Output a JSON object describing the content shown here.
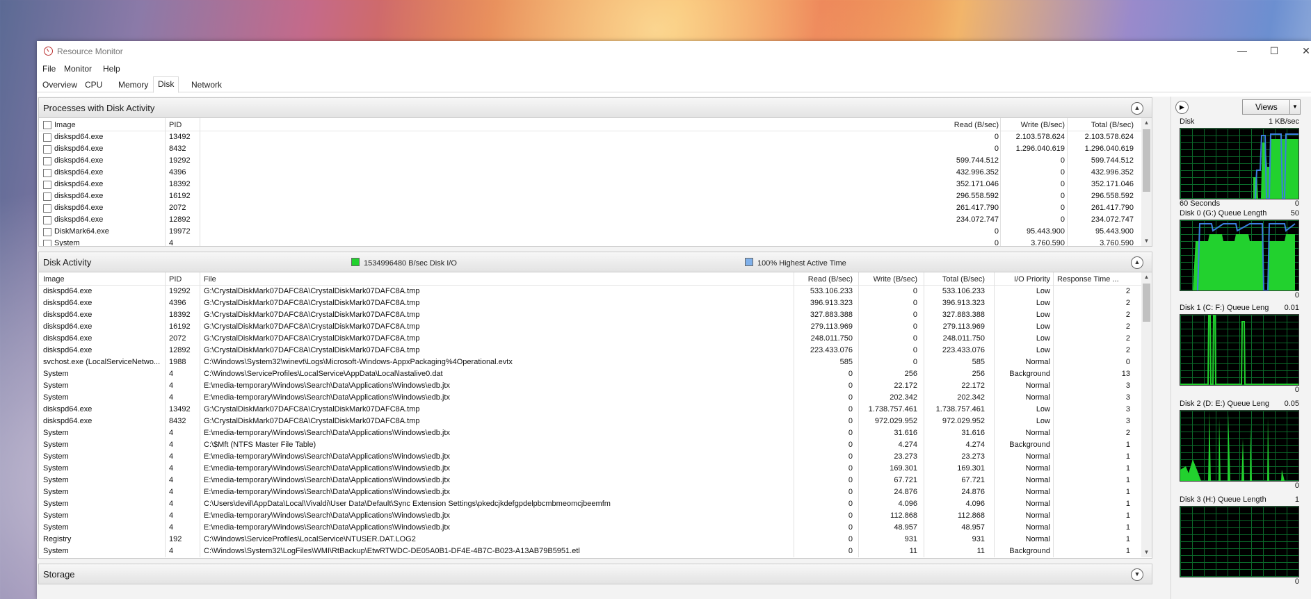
{
  "window": {
    "title": "Resource Monitor",
    "controls": {
      "minimize": "—",
      "maximize": "☐",
      "close": "✕"
    }
  },
  "menu": [
    "File",
    "Monitor",
    "Help"
  ],
  "tabs": [
    "Overview",
    "CPU",
    "Memory",
    "Disk",
    "Network"
  ],
  "active_tab": "Disk",
  "processes": {
    "title": "Processes with Disk Activity",
    "headers": {
      "image": "Image",
      "pid": "PID",
      "read": "Read (B/sec)",
      "write": "Write (B/sec)",
      "total": "Total (B/sec)"
    },
    "rows": [
      {
        "image": "diskspd64.exe",
        "pid": "13492",
        "read": "0",
        "write": "2.103.578.624",
        "total": "2.103.578.624"
      },
      {
        "image": "diskspd64.exe",
        "pid": "8432",
        "read": "0",
        "write": "1.296.040.619",
        "total": "1.296.040.619"
      },
      {
        "image": "diskspd64.exe",
        "pid": "19292",
        "read": "599.744.512",
        "write": "0",
        "total": "599.744.512"
      },
      {
        "image": "diskspd64.exe",
        "pid": "4396",
        "read": "432.996.352",
        "write": "0",
        "total": "432.996.352"
      },
      {
        "image": "diskspd64.exe",
        "pid": "18392",
        "read": "352.171.046",
        "write": "0",
        "total": "352.171.046"
      },
      {
        "image": "diskspd64.exe",
        "pid": "16192",
        "read": "296.558.592",
        "write": "0",
        "total": "296.558.592"
      },
      {
        "image": "diskspd64.exe",
        "pid": "2072",
        "read": "261.417.790",
        "write": "0",
        "total": "261.417.790"
      },
      {
        "image": "diskspd64.exe",
        "pid": "12892",
        "read": "234.072.747",
        "write": "0",
        "total": "234.072.747"
      },
      {
        "image": "DiskMark64.exe",
        "pid": "19972",
        "read": "0",
        "write": "95.443.900",
        "total": "95.443.900"
      },
      {
        "image": "System",
        "pid": "4",
        "read": "0",
        "write": "3.760.590",
        "total": "3.760.590"
      }
    ]
  },
  "disk_activity": {
    "title": "Disk Activity",
    "legend_io": "1534996480 B/sec Disk I/O",
    "legend_active": "100% Highest Active Time",
    "colors": {
      "io": "#22d12e",
      "active": "#7fb0ea"
    },
    "headers": {
      "image": "Image",
      "pid": "PID",
      "file": "File",
      "read": "Read (B/sec)",
      "write": "Write (B/sec)",
      "total": "Total (B/sec)",
      "priority": "I/O Priority",
      "response": "Response Time ..."
    },
    "rows": [
      {
        "image": "diskspd64.exe",
        "pid": "19292",
        "file": "G:\\CrystalDiskMark07DAFC8A\\CrystalDiskMark07DAFC8A.tmp",
        "read": "533.106.233",
        "write": "0",
        "total": "533.106.233",
        "priority": "Low",
        "response": "2"
      },
      {
        "image": "diskspd64.exe",
        "pid": "4396",
        "file": "G:\\CrystalDiskMark07DAFC8A\\CrystalDiskMark07DAFC8A.tmp",
        "read": "396.913.323",
        "write": "0",
        "total": "396.913.323",
        "priority": "Low",
        "response": "2"
      },
      {
        "image": "diskspd64.exe",
        "pid": "18392",
        "file": "G:\\CrystalDiskMark07DAFC8A\\CrystalDiskMark07DAFC8A.tmp",
        "read": "327.883.388",
        "write": "0",
        "total": "327.883.388",
        "priority": "Low",
        "response": "2"
      },
      {
        "image": "diskspd64.exe",
        "pid": "16192",
        "file": "G:\\CrystalDiskMark07DAFC8A\\CrystalDiskMark07DAFC8A.tmp",
        "read": "279.113.969",
        "write": "0",
        "total": "279.113.969",
        "priority": "Low",
        "response": "2"
      },
      {
        "image": "diskspd64.exe",
        "pid": "2072",
        "file": "G:\\CrystalDiskMark07DAFC8A\\CrystalDiskMark07DAFC8A.tmp",
        "read": "248.011.750",
        "write": "0",
        "total": "248.011.750",
        "priority": "Low",
        "response": "2"
      },
      {
        "image": "diskspd64.exe",
        "pid": "12892",
        "file": "G:\\CrystalDiskMark07DAFC8A\\CrystalDiskMark07DAFC8A.tmp",
        "read": "223.433.076",
        "write": "0",
        "total": "223.433.076",
        "priority": "Low",
        "response": "2"
      },
      {
        "image": "svchost.exe (LocalServiceNetwo...",
        "pid": "1988",
        "file": "C:\\Windows\\System32\\winevt\\Logs\\Microsoft-Windows-AppxPackaging%4Operational.evtx",
        "read": "585",
        "write": "0",
        "total": "585",
        "priority": "Normal",
        "response": "0"
      },
      {
        "image": "System",
        "pid": "4",
        "file": "C:\\Windows\\ServiceProfiles\\LocalService\\AppData\\Local\\lastalive0.dat",
        "read": "0",
        "write": "256",
        "total": "256",
        "priority": "Background",
        "response": "13"
      },
      {
        "image": "System",
        "pid": "4",
        "file": "E:\\media-temporary\\Windows\\Search\\Data\\Applications\\Windows\\edb.jtx",
        "read": "0",
        "write": "22.172",
        "total": "22.172",
        "priority": "Normal",
        "response": "3"
      },
      {
        "image": "System",
        "pid": "4",
        "file": "E:\\media-temporary\\Windows\\Search\\Data\\Applications\\Windows\\edb.jtx",
        "read": "0",
        "write": "202.342",
        "total": "202.342",
        "priority": "Normal",
        "response": "3"
      },
      {
        "image": "diskspd64.exe",
        "pid": "13492",
        "file": "G:\\CrystalDiskMark07DAFC8A\\CrystalDiskMark07DAFC8A.tmp",
        "read": "0",
        "write": "1.738.757.461",
        "total": "1.738.757.461",
        "priority": "Low",
        "response": "3"
      },
      {
        "image": "diskspd64.exe",
        "pid": "8432",
        "file": "G:\\CrystalDiskMark07DAFC8A\\CrystalDiskMark07DAFC8A.tmp",
        "read": "0",
        "write": "972.029.952",
        "total": "972.029.952",
        "priority": "Low",
        "response": "3"
      },
      {
        "image": "System",
        "pid": "4",
        "file": "E:\\media-temporary\\Windows\\Search\\Data\\Applications\\Windows\\edb.jtx",
        "read": "0",
        "write": "31.616",
        "total": "31.616",
        "priority": "Normal",
        "response": "2"
      },
      {
        "image": "System",
        "pid": "4",
        "file": "C:\\$Mft (NTFS Master File Table)",
        "read": "0",
        "write": "4.274",
        "total": "4.274",
        "priority": "Background",
        "response": "1"
      },
      {
        "image": "System",
        "pid": "4",
        "file": "E:\\media-temporary\\Windows\\Search\\Data\\Applications\\Windows\\edb.jtx",
        "read": "0",
        "write": "23.273",
        "total": "23.273",
        "priority": "Normal",
        "response": "1"
      },
      {
        "image": "System",
        "pid": "4",
        "file": "E:\\media-temporary\\Windows\\Search\\Data\\Applications\\Windows\\edb.jtx",
        "read": "0",
        "write": "169.301",
        "total": "169.301",
        "priority": "Normal",
        "response": "1"
      },
      {
        "image": "System",
        "pid": "4",
        "file": "E:\\media-temporary\\Windows\\Search\\Data\\Applications\\Windows\\edb.jtx",
        "read": "0",
        "write": "67.721",
        "total": "67.721",
        "priority": "Normal",
        "response": "1"
      },
      {
        "image": "System",
        "pid": "4",
        "file": "E:\\media-temporary\\Windows\\Search\\Data\\Applications\\Windows\\edb.jtx",
        "read": "0",
        "write": "24.876",
        "total": "24.876",
        "priority": "Normal",
        "response": "1"
      },
      {
        "image": "System",
        "pid": "4",
        "file": "C:\\Users\\devil\\AppData\\Local\\Vivaldi\\User Data\\Default\\Sync Extension Settings\\pkedcjkdefgpdelpbcmbmeomcjbeemfm",
        "read": "0",
        "write": "4.096",
        "total": "4.096",
        "priority": "Normal",
        "response": "1"
      },
      {
        "image": "System",
        "pid": "4",
        "file": "E:\\media-temporary\\Windows\\Search\\Data\\Applications\\Windows\\edb.jtx",
        "read": "0",
        "write": "112.868",
        "total": "112.868",
        "priority": "Normal",
        "response": "1"
      },
      {
        "image": "System",
        "pid": "4",
        "file": "E:\\media-temporary\\Windows\\Search\\Data\\Applications\\Windows\\edb.jtx",
        "read": "0",
        "write": "48.957",
        "total": "48.957",
        "priority": "Normal",
        "response": "1"
      },
      {
        "image": "Registry",
        "pid": "192",
        "file": "C:\\Windows\\ServiceProfiles\\LocalService\\NTUSER.DAT.LOG2",
        "read": "0",
        "write": "931",
        "total": "931",
        "priority": "Normal",
        "response": "1"
      },
      {
        "image": "System",
        "pid": "4",
        "file": "C:\\Windows\\System32\\LogFiles\\WMI\\RtBackup\\EtwRTWDC-DE05A0B1-DF4E-4B7C-B023-A13AB79B5951.etl",
        "read": "0",
        "write": "11",
        "total": "11",
        "priority": "Background",
        "response": "1"
      }
    ]
  },
  "storage": {
    "title": "Storage"
  },
  "sidebar": {
    "views_label": "Views",
    "graphs": [
      {
        "label": "Disk",
        "max": "1 KB/sec",
        "footer_left": "60 Seconds",
        "min": "0"
      },
      {
        "label": "Disk 0 (G:) Queue Length",
        "max": "50",
        "min": "0"
      },
      {
        "label": "Disk 1 (C: F:) Queue Leng",
        "max": "0.01",
        "min": "0"
      },
      {
        "label": "Disk 2 (D: E:) Queue Leng",
        "max": "0.05",
        "min": "0"
      },
      {
        "label": "Disk 3 (H:) Queue Length",
        "max": "1",
        "min": "0"
      }
    ],
    "colors": {
      "green": "#22d12e",
      "blue": "#3a7fe0",
      "grid": "#0b6a2a"
    }
  }
}
